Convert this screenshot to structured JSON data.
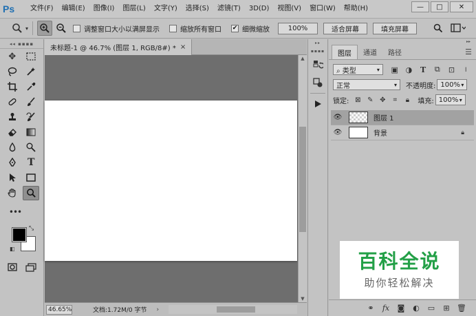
{
  "app": {
    "logo": "Ps",
    "menu": [
      "文件(F)",
      "编辑(E)",
      "图像(I)",
      "图层(L)",
      "文字(Y)",
      "选择(S)",
      "滤镜(T)",
      "3D(D)",
      "视图(V)",
      "窗口(W)",
      "帮助(H)"
    ],
    "window_controls": {
      "minimize": "—",
      "restore": "□",
      "close": "✕"
    }
  },
  "options_bar": {
    "tool_icon": "zoom-icon",
    "checkboxes": [
      {
        "label": "调整窗口大小以满屏显示",
        "checked": false
      },
      {
        "label": "缩放所有窗口",
        "checked": false
      },
      {
        "label": "细微缩放",
        "checked": true
      }
    ],
    "buttons": [
      "100%",
      "适合屏幕",
      "填充屏幕"
    ]
  },
  "document": {
    "tab_title": "未标题-1 @ 46.7% (图层 1, RGB/8#) *",
    "tab_close": "×",
    "status": {
      "zoom": "46.65%",
      "info": "文档:1.72M/0 字节",
      "arrow": "›"
    }
  },
  "layers_panel": {
    "tabs": [
      "图层",
      "通道",
      "路径"
    ],
    "active_tab": "图层",
    "filter_kind": "类型",
    "blend_mode": "正常",
    "opacity_label": "不透明度:",
    "opacity_value": "100%",
    "lock_label": "锁定:",
    "fill_label": "填充:",
    "fill_value": "100%",
    "layers": [
      {
        "name": "图层 1",
        "selected": true,
        "thumb": "transparent",
        "locked": false
      },
      {
        "name": "背景",
        "selected": false,
        "thumb": "white",
        "locked": true
      }
    ]
  },
  "watermark": {
    "title": "百科全说",
    "subtitle": "助你轻松解决"
  }
}
